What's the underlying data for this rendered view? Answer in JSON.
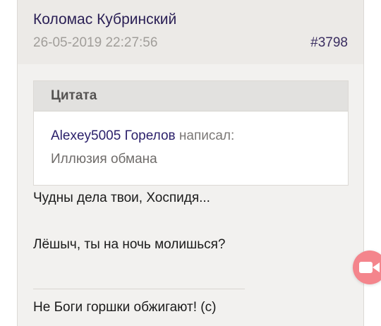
{
  "post": {
    "author": "Коломас Кубринский",
    "date": "26-05-2019 22:27:56",
    "number": "#3798",
    "quote": {
      "title": "Цитата",
      "author": "Alexey5005 Горелов",
      "wrote": "написал:",
      "text": "Иллюзия обмана"
    },
    "lines": [
      "Чудны дела твои, Хоспидя...",
      "Лёшыч, ты на ночь молишься?"
    ],
    "signature": "Не Боги горшки обжигают! (с)"
  },
  "fab": {
    "icon": "video-camera-icon",
    "color": "#f4858c"
  }
}
